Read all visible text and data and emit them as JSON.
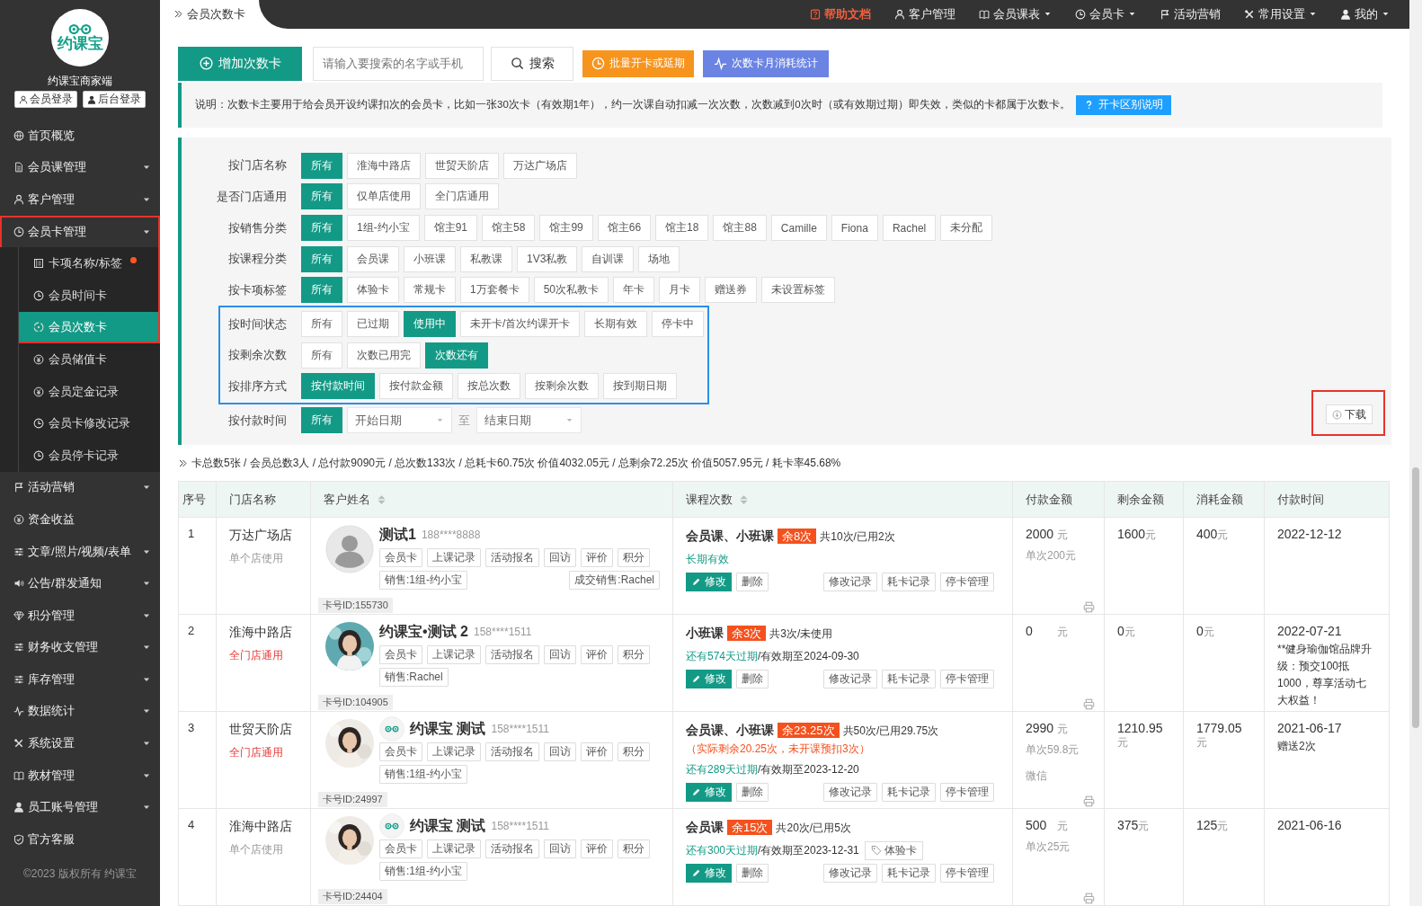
{
  "sidebar": {
    "logo": "约课宝",
    "brand": "约课宝商家端",
    "logins": [
      "会员登录",
      "后台登录"
    ],
    "items": [
      {
        "label": "首页概览",
        "dropdown": false,
        "framed": false
      },
      {
        "label": "会员课管理",
        "dropdown": true,
        "framed": false
      },
      {
        "label": "客户管理",
        "dropdown": true,
        "framed": false
      },
      {
        "label": "会员卡管理",
        "dropdown": true,
        "framed": true,
        "children": [
          {
            "label": "卡项名称/标签",
            "selected": false,
            "new": true,
            "framed": true
          },
          {
            "label": "会员时间卡",
            "selected": false,
            "new": false,
            "framed": true
          },
          {
            "label": "会员次数卡",
            "selected": true,
            "new": false,
            "framed": true
          },
          {
            "label": "会员储值卡",
            "selected": false,
            "new": false,
            "framed": false
          },
          {
            "label": "会员定金记录",
            "selected": false,
            "new": false,
            "framed": false
          },
          {
            "label": "会员卡修改记录",
            "selected": false,
            "new": false,
            "framed": false
          },
          {
            "label": "会员停卡记录",
            "selected": false,
            "new": false,
            "framed": false
          }
        ]
      },
      {
        "label": "活动营销",
        "dropdown": true,
        "framed": false
      },
      {
        "label": "资金收益",
        "dropdown": false,
        "framed": false
      },
      {
        "label": "文章/照片/视频/表单",
        "dropdown": true,
        "framed": false
      },
      {
        "label": "公告/群发通知",
        "dropdown": true,
        "framed": false
      },
      {
        "label": "积分管理",
        "dropdown": true,
        "framed": false
      },
      {
        "label": "财务收支管理",
        "dropdown": true,
        "framed": false
      },
      {
        "label": "库存管理",
        "dropdown": true,
        "framed": false
      },
      {
        "label": "数据统计",
        "dropdown": true,
        "framed": false
      },
      {
        "label": "系统设置",
        "dropdown": true,
        "framed": false
      },
      {
        "label": "教材管理",
        "dropdown": true,
        "framed": false
      },
      {
        "label": "员工账号管理",
        "dropdown": true,
        "framed": false
      },
      {
        "label": "官方客服",
        "dropdown": false,
        "framed": false
      }
    ],
    "footer": "©2023 版权所有 约课宝"
  },
  "breadcrumb": "会员次数卡",
  "nav": [
    {
      "label": "帮助文档",
      "kind": "help",
      "dropdown": false
    },
    {
      "label": "客户管理",
      "kind": "link",
      "dropdown": false
    },
    {
      "label": "会员课表",
      "kind": "link",
      "dropdown": true
    },
    {
      "label": "会员卡",
      "kind": "link",
      "dropdown": true
    },
    {
      "label": "活动营销",
      "kind": "link",
      "dropdown": false
    },
    {
      "label": "常用设置",
      "kind": "link",
      "dropdown": true
    },
    {
      "label": "我的",
      "kind": "link",
      "dropdown": true
    }
  ],
  "toolbar": {
    "add": "增加次数卡",
    "search": {
      "placeholder": "请输入要搜索的名字或手机"
    },
    "search_button": "搜索",
    "batch": "批量开卡或延期",
    "stats": "次数卡月消耗统计"
  },
  "notice": {
    "text": "说明：次数卡主要用于给会员开设约课扣次的会员卡，比如一张30次卡（有效期1年），约一次课自动扣减一次次数，次数减到0次时（或有效期过期）即失效，类似的卡都属于次数卡。",
    "button": "开卡区别说明"
  },
  "filters": {
    "groups": [
      {
        "framed": false,
        "rows": [
          {
            "label": "按门店名称",
            "options": [
              {
                "label": "所有",
                "selected": true
              },
              {
                "label": "淮海中路店",
                "selected": false
              },
              {
                "label": "世贸天阶店",
                "selected": false
              },
              {
                "label": "万达广场店",
                "selected": false
              }
            ]
          },
          {
            "label": "是否门店通用",
            "options": [
              {
                "label": "所有",
                "selected": true
              },
              {
                "label": "仅单店使用",
                "selected": false
              },
              {
                "label": "全门店通用",
                "selected": false
              }
            ]
          },
          {
            "label": "按销售分类",
            "options": [
              {
                "label": "所有",
                "selected": true
              },
              {
                "label": "1组-约小宝",
                "selected": false
              },
              {
                "label": "馆主91",
                "selected": false
              },
              {
                "label": "馆主58",
                "selected": false
              },
              {
                "label": "馆主99",
                "selected": false
              },
              {
                "label": "馆主66",
                "selected": false
              },
              {
                "label": "馆主18",
                "selected": false
              },
              {
                "label": "馆主88",
                "selected": false
              },
              {
                "label": "Camille",
                "selected": false
              },
              {
                "label": "Fiona",
                "selected": false
              },
              {
                "label": "Rachel",
                "selected": false
              },
              {
                "label": "未分配",
                "selected": false
              }
            ]
          },
          {
            "label": "按课程分类",
            "options": [
              {
                "label": "所有",
                "selected": true
              },
              {
                "label": "会员课",
                "selected": false
              },
              {
                "label": "小班课",
                "selected": false
              },
              {
                "label": "私教课",
                "selected": false
              },
              {
                "label": "1V3私教",
                "selected": false
              },
              {
                "label": "自训课",
                "selected": false
              },
              {
                "label": "场地",
                "selected": false
              }
            ]
          },
          {
            "label": "按卡项标签",
            "options": [
              {
                "label": "所有",
                "selected": true
              },
              {
                "label": "体验卡",
                "selected": false
              },
              {
                "label": "常规卡",
                "selected": false
              },
              {
                "label": "1万套餐卡",
                "selected": false
              },
              {
                "label": "50次私教卡",
                "selected": false
              },
              {
                "label": "年卡",
                "selected": false
              },
              {
                "label": "月卡",
                "selected": false
              },
              {
                "label": "赠送券",
                "selected": false
              },
              {
                "label": "未设置标签",
                "selected": false
              }
            ]
          }
        ]
      },
      {
        "framed": true,
        "rows": [
          {
            "label": "按时间状态",
            "options": [
              {
                "label": "所有",
                "selected": false
              },
              {
                "label": "已过期",
                "selected": false
              },
              {
                "label": "使用中",
                "selected": true
              },
              {
                "label": "未开卡/首次约课开卡",
                "selected": false
              },
              {
                "label": "长期有效",
                "selected": false
              },
              {
                "label": "停卡中",
                "selected": false
              }
            ]
          },
          {
            "label": "按剩余次数",
            "options": [
              {
                "label": "所有",
                "selected": false
              },
              {
                "label": "次数已用完",
                "selected": false
              },
              {
                "label": "次数还有",
                "selected": true
              }
            ]
          },
          {
            "label": "按排序方式",
            "options": [
              {
                "label": "按付款时间",
                "selected": true
              },
              {
                "label": "按付款金额",
                "selected": false
              },
              {
                "label": "按总次数",
                "selected": false
              },
              {
                "label": "按剩余次数",
                "selected": false
              },
              {
                "label": "按到期日期",
                "selected": false
              }
            ]
          }
        ]
      }
    ],
    "date": {
      "label": "按付款时间",
      "all": {
        "label": "所有",
        "selected": true
      },
      "start": {
        "placeholder": "开始日期"
      },
      "to": "至",
      "end": {
        "placeholder": "结束日期"
      }
    },
    "download": {
      "label": "下载",
      "framed": true
    }
  },
  "summary": "卡总数5张 / 会员总数3人 / 总付款9090元 / 总次数133次 / 总耗卡60.75次 价值4032.05元 / 总剩余72.25次 价值5057.95元 / 耗卡率45.68%",
  "table": {
    "columns": [
      {
        "label": "序号",
        "sortable": false
      },
      {
        "label": "门店名称",
        "sortable": false
      },
      {
        "label": "客户姓名",
        "sortable": true
      },
      {
        "label": "课程次数",
        "sortable": true
      },
      {
        "label": "付款金额",
        "sortable": false
      },
      {
        "label": "剩余金额",
        "sortable": false
      },
      {
        "label": "消耗金额",
        "sortable": false
      },
      {
        "label": "付款时间",
        "sortable": false
      }
    ],
    "rows": [
      {
        "index": "1",
        "store": "万达广场店",
        "scope": {
          "text": "单个店使用",
          "kind": "single"
        },
        "avatar": {
          "kind": "default"
        },
        "logo_badge": false,
        "name": "测试1",
        "phone": "188****8888",
        "tags": [
          "会员卡",
          "上课记录",
          "活动报名",
          "回访",
          "评价",
          "积分"
        ],
        "sales": "销售:1组-约小宝",
        "closer": "成交销售:Rachel",
        "card_id": "卡号ID:155730",
        "course": "会员课、小班课",
        "remaining": "余8次",
        "total": "共10次/已用2次",
        "validity": "长期有效",
        "edit": "修改",
        "delete": "删除",
        "actions": [
          "修改记录",
          "耗卡记录",
          "停卡管理"
        ],
        "paid": "2000",
        "paid_unit": "元",
        "per_class": "单次200元",
        "balance": "1600",
        "balance_unit": "元",
        "consumed": "400",
        "consumed_unit": "元",
        "date": "2022-12-12"
      },
      {
        "index": "2",
        "store": "淮海中路店",
        "scope": {
          "text": "全门店通用",
          "kind": "all"
        },
        "avatar": {
          "kind": "picture"
        },
        "logo_badge": false,
        "name": "约课宝•测试 2",
        "phone": "158****1511",
        "tags": [
          "会员卡",
          "上课记录",
          "活动报名",
          "回访",
          "评价",
          "积分"
        ],
        "sales": "销售:Rachel",
        "card_id": "卡号ID:104905",
        "course": "小班课",
        "remaining": "余3次",
        "total": "共3次/未使用",
        "validity": "还有574天过期",
        "expiry": "/有效期至2024-09-30",
        "edit": "修改",
        "delete": "删除",
        "actions": [
          "修改记录",
          "耗卡记录",
          "停卡管理"
        ],
        "paid": "0",
        "paid_unit": "元",
        "balance": "0",
        "balance_unit": "元",
        "consumed": "0",
        "consumed_unit": "元",
        "date": "2022-07-21",
        "remark": "**健身瑜伽馆品牌升级：预交100抵1000，尊享活动七大权益！"
      },
      {
        "index": "3",
        "store": "世贸天阶店",
        "scope": {
          "text": "全门店通用",
          "kind": "all"
        },
        "avatar": {
          "kind": "picture"
        },
        "logo_badge": true,
        "name": "约课宝 测试",
        "phone": "158****1511",
        "tags": [
          "会员卡",
          "上课记录",
          "活动报名",
          "回访",
          "评价",
          "积分"
        ],
        "sales": "销售:1组-约小宝",
        "card_id": "卡号ID:24997",
        "course": "会员课、小班课",
        "remaining": "余23.25次",
        "total": "共50次/已用29.75次",
        "note": "（实际剩余20.25次，未开课预扣3次）",
        "validity": "还有289天过期",
        "expiry": "/有效期至2023-12-20",
        "edit": "修改",
        "delete": "删除",
        "actions": [
          "修改记录",
          "耗卡记录",
          "停卡管理"
        ],
        "paid": "2990",
        "paid_unit": "元",
        "per_class": "单次59.8元",
        "method": "微信",
        "balance": "1210.95",
        "balance_unit": "元",
        "consumed": "1779.05",
        "consumed_unit": "元",
        "date": "2021-06-17",
        "remark": "赠送2次"
      },
      {
        "index": "4",
        "store": "淮海中路店",
        "scope": {
          "text": "单个店使用",
          "kind": "single"
        },
        "avatar": {
          "kind": "picture"
        },
        "logo_badge": true,
        "name": "约课宝 测试",
        "phone": "158****1511",
        "tags": [
          "会员卡",
          "上课记录",
          "活动报名",
          "回访",
          "评价",
          "积分"
        ],
        "sales": "销售:1组-约小宝",
        "card_id": "卡号ID:24404",
        "course": "会员课",
        "remaining": "余15次",
        "total": "共20次/已用5次",
        "validity": "还有300天过期",
        "expiry": "/有效期至2023-12-31",
        "card_tag": "体验卡",
        "edit": "修改",
        "delete": "删除",
        "actions": [
          "修改记录",
          "耗卡记录",
          "停卡管理"
        ],
        "paid": "500",
        "paid_unit": "元",
        "per_class": "单次25元",
        "balance": "375",
        "balance_unit": "元",
        "consumed": "125",
        "consumed_unit": "元",
        "date": "2021-06-16"
      }
    ]
  }
}
